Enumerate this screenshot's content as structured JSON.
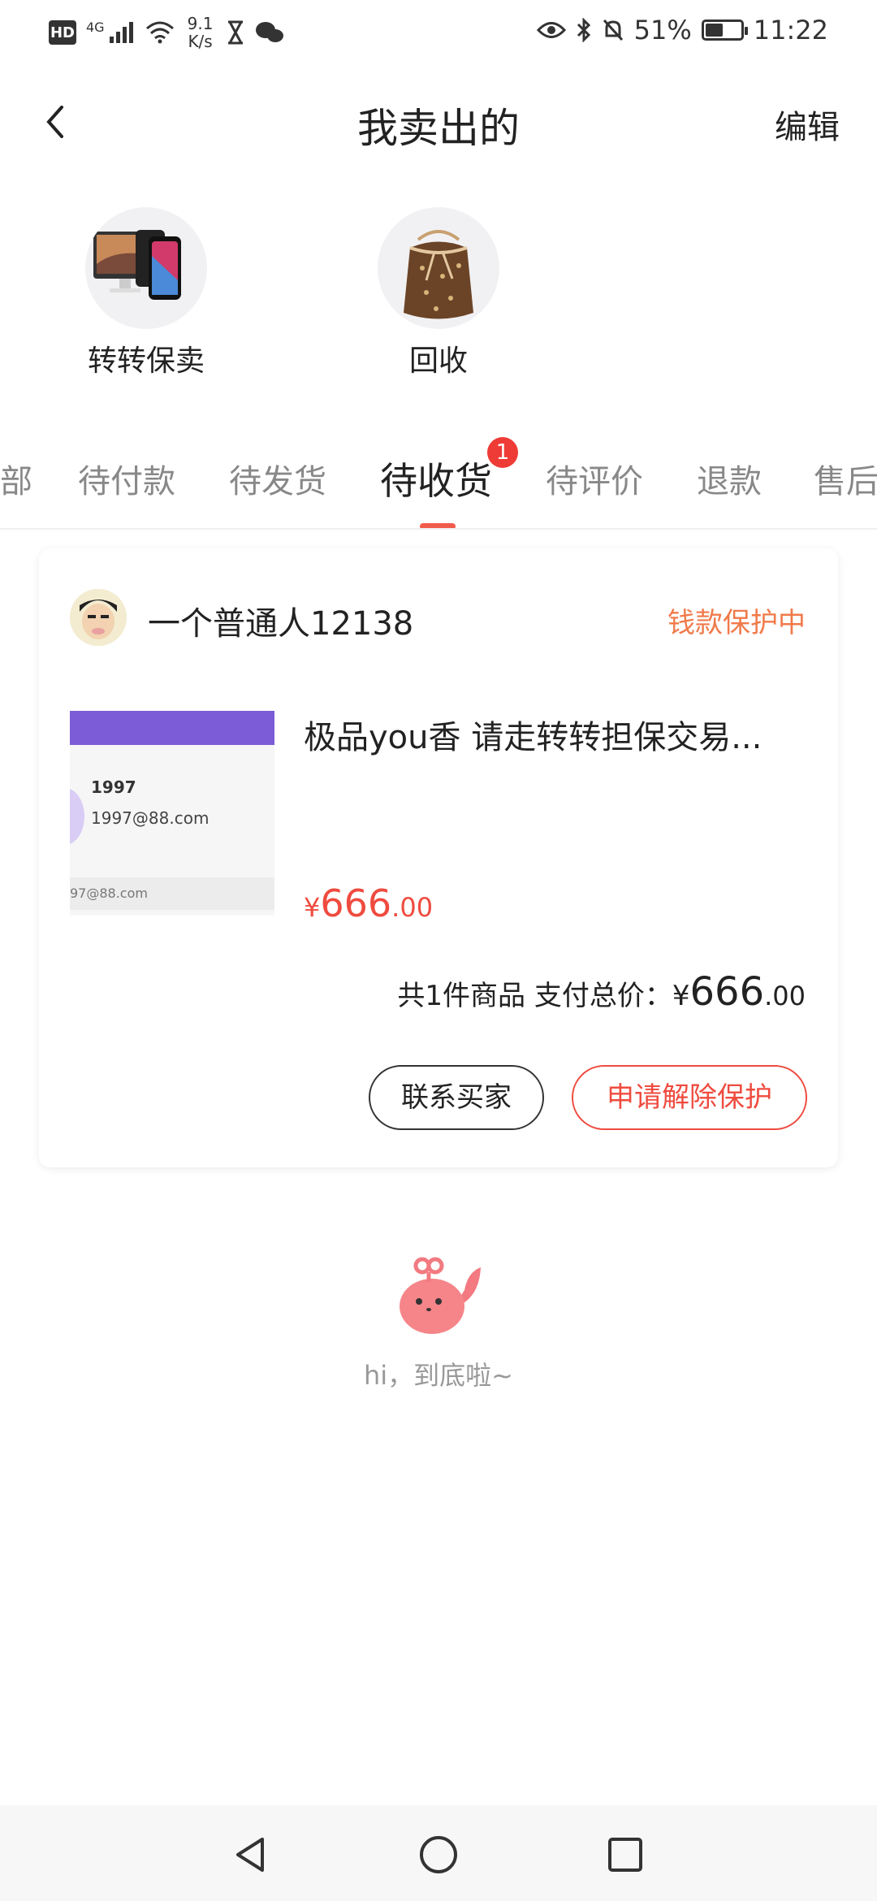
{
  "status_bar": {
    "hd": "HD",
    "network": "4G",
    "speed_value": "9.1",
    "speed_unit": "K/s",
    "battery_percent": "51%",
    "battery_level": 0.51,
    "time": "11:22"
  },
  "header": {
    "title": "我卖出的",
    "edit_label": "编辑"
  },
  "services": [
    {
      "label": "转转保卖",
      "icon": "electronics-devices-icon"
    },
    {
      "label": "回收",
      "icon": "handbag-icon"
    }
  ],
  "tabs": [
    {
      "label": "部"
    },
    {
      "label": "待付款"
    },
    {
      "label": "待发货"
    },
    {
      "label": "待收货",
      "active": true,
      "badge": "1"
    },
    {
      "label": "待评价"
    },
    {
      "label": "退款"
    },
    {
      "label": "售后"
    }
  ],
  "order": {
    "seller_name": "一个普通人12138",
    "status": "钱款保护中",
    "thumbnail": {
      "line1": "1997",
      "line2": "1997@88.com",
      "line3": "97@88.com"
    },
    "product_title": "极品you香  请走转转担保交易...",
    "price": {
      "currency": "¥",
      "integer": "666",
      "decimal": ".00"
    },
    "summary": {
      "label": "共1件商品 支付总价：",
      "currency": "¥",
      "integer": "666",
      "decimal": ".00"
    },
    "buttons": {
      "contact": "联系买家",
      "release": "申请解除保护"
    }
  },
  "end_hint": "hi，到底啦~",
  "colors": {
    "accent": "#ef4b3f",
    "status_orange": "#f07a4a",
    "tab_inactive": "#888888",
    "hint_gray": "#999999"
  }
}
